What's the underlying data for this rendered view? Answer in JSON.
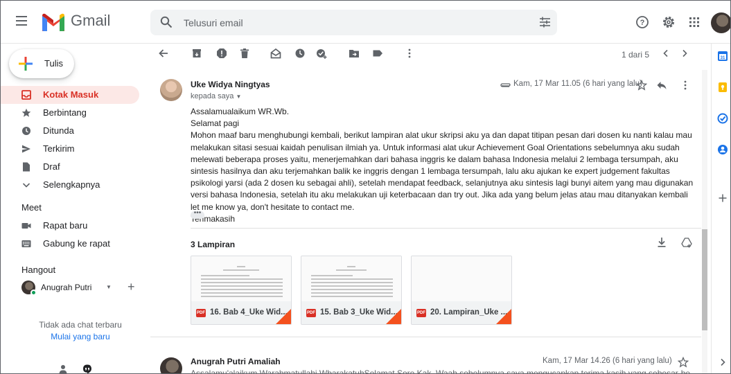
{
  "app": {
    "name": "Gmail"
  },
  "search": {
    "placeholder": "Telusuri email"
  },
  "compose": {
    "label": "Tulis"
  },
  "nav": {
    "items": [
      {
        "label": "Kotak Masuk",
        "icon": "inbox-icon",
        "active": true
      },
      {
        "label": "Berbintang",
        "icon": "star-icon"
      },
      {
        "label": "Ditunda",
        "icon": "clock-icon"
      },
      {
        "label": "Terkirim",
        "icon": "send-icon"
      },
      {
        "label": "Draf",
        "icon": "draft-icon"
      },
      {
        "label": "Selengkapnya",
        "icon": "chevron-down-icon"
      }
    ],
    "meet": {
      "title": "Meet",
      "items": [
        {
          "label": "Rapat baru",
          "icon": "video-icon"
        },
        {
          "label": "Gabung ke rapat",
          "icon": "keyboard-icon"
        }
      ]
    },
    "hangout": {
      "title": "Hangout",
      "user": "Anugrah Putri",
      "no_chat": "Tidak ada chat terbaru",
      "start_new": "Mulai yang baru"
    }
  },
  "toolbar": {
    "pager": "1 dari 5"
  },
  "message": {
    "sender": "Uke Widya Ningtyas",
    "to": "kepada saya",
    "date": "Kam, 17 Mar 11.05 (6 hari yang lalu)",
    "body": [
      "Assalamualaikum WR.Wb.",
      "Selamat pagi",
      "Mohon maaf baru menghubungi kembali, berikut lampiran alat ukur skripsi aku ya dan dapat titipan pesan dari dosen ku nanti kalau mau melakukan sitasi sesuai kaidah penulisan ilmiah ya. Untuk informasi alat ukur Achievement Goal Orientations sebelumnya aku sudah melewati beberapa proses yaitu, menerjemahkan dari bahasa inggris ke dalam bahasa Indonesia melalui 2 lembaga tersumpah, aku sintesis hasilnya dan aku terjemahkan balik ke inggris dengan 1 lembaga tersumpah, lalu aku ajukan ke expert judgement fakultas psikologi yarsi (ada 2 dosen ku sebagai ahli), setelah mendapat feedback, selanjutnya aku sintesis lagi bunyi aitem yang mau digunakan versi bahasa Indonesia, setelah itu aku melakukan uji keterbacaan dan try out. Jika ada yang belum jelas atau mau ditanyakan kembali let me know ya, don't hesitate to contact me.",
      "Terimakasih"
    ],
    "attachments_title": "3 Lampiran",
    "attachments": [
      {
        "name": "16. Bab 4_Uke Wid...",
        "type": "PDF"
      },
      {
        "name": "15. Bab 3_Uke Wid...",
        "type": "PDF"
      },
      {
        "name": "20. Lampiran_Uke ...",
        "type": "PDF"
      }
    ]
  },
  "message2": {
    "sender": "Anugrah Putri Amaliah",
    "date": "Kam, 17 Mar 14.26 (6 hari yang lalu)",
    "snippet": "Assalamu'alaikum Warahmatullahi WbarakatuhSelamat Sore Kak. Waah sebelumnya saya mengucapkan terima kasih yang sebesar-besarnya atas..."
  },
  "colors": {
    "accent_red": "#d93025",
    "active_bg": "#fce8e6",
    "link_blue": "#1a73e8"
  }
}
